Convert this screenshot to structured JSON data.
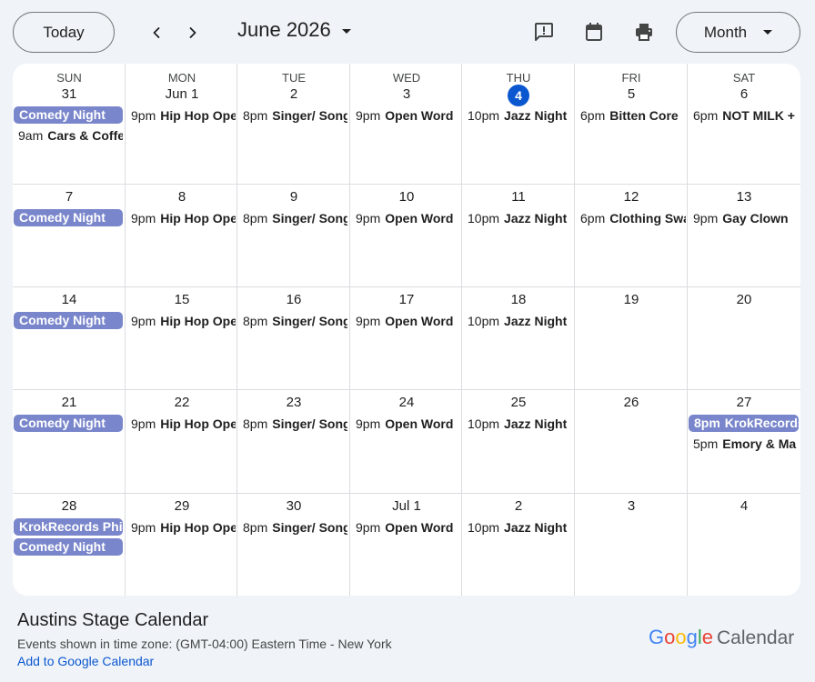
{
  "toolbar": {
    "today_label": "Today",
    "month_title": "June 2026",
    "view_label": "Month",
    "icons": [
      "chevron-left-icon",
      "chevron-right-icon",
      "feedback-icon",
      "calendar-icon",
      "print-icon"
    ]
  },
  "weekdays": [
    "SUN",
    "MON",
    "TUE",
    "WED",
    "THU",
    "FRI",
    "SAT"
  ],
  "weeks": [
    {
      "days": [
        {
          "label": "31",
          "events": [
            {
              "time": "",
              "name": "Comedy Night",
              "bar": true
            },
            {
              "time": "9am",
              "name": "Cars & Coffee"
            }
          ]
        },
        {
          "label": "Jun 1",
          "events": [
            {
              "time": "9pm",
              "name": "Hip Hop Open Mic"
            }
          ]
        },
        {
          "label": "2",
          "events": [
            {
              "time": "8pm",
              "name": "Singer/ Songwriter"
            }
          ]
        },
        {
          "label": "3",
          "events": [
            {
              "time": "9pm",
              "name": "Open Word"
            }
          ]
        },
        {
          "label": "4",
          "today": true,
          "events": [
            {
              "time": "10pm",
              "name": "Jazz Night"
            }
          ]
        },
        {
          "label": "5",
          "events": [
            {
              "time": "6pm",
              "name": "Bitten Core"
            }
          ]
        },
        {
          "label": "6",
          "events": [
            {
              "time": "6pm",
              "name": "NOT MILK +"
            }
          ]
        }
      ]
    },
    {
      "days": [
        {
          "label": "7",
          "events": [
            {
              "time": "",
              "name": "Comedy Night",
              "bar": true
            }
          ]
        },
        {
          "label": "8",
          "events": [
            {
              "time": "9pm",
              "name": "Hip Hop Open Mic"
            }
          ]
        },
        {
          "label": "9",
          "events": [
            {
              "time": "8pm",
              "name": "Singer/ Songwriter"
            }
          ]
        },
        {
          "label": "10",
          "events": [
            {
              "time": "9pm",
              "name": "Open Word"
            }
          ]
        },
        {
          "label": "11",
          "events": [
            {
              "time": "10pm",
              "name": "Jazz Night"
            }
          ]
        },
        {
          "label": "12",
          "events": [
            {
              "time": "6pm",
              "name": "Clothing Swap"
            }
          ]
        },
        {
          "label": "13",
          "events": [
            {
              "time": "9pm",
              "name": "Gay Clown"
            }
          ]
        }
      ]
    },
    {
      "days": [
        {
          "label": "14",
          "events": [
            {
              "time": "",
              "name": "Comedy Night",
              "bar": true
            }
          ]
        },
        {
          "label": "15",
          "events": [
            {
              "time": "9pm",
              "name": "Hip Hop Open Mic"
            }
          ]
        },
        {
          "label": "16",
          "events": [
            {
              "time": "8pm",
              "name": "Singer/ Songwriter"
            }
          ]
        },
        {
          "label": "17",
          "events": [
            {
              "time": "9pm",
              "name": "Open Word"
            }
          ]
        },
        {
          "label": "18",
          "events": [
            {
              "time": "10pm",
              "name": "Jazz Night"
            }
          ]
        },
        {
          "label": "19",
          "events": []
        },
        {
          "label": "20",
          "events": []
        }
      ]
    },
    {
      "days": [
        {
          "label": "21",
          "events": [
            {
              "time": "",
              "name": "Comedy Night",
              "bar": true
            }
          ]
        },
        {
          "label": "22",
          "events": [
            {
              "time": "9pm",
              "name": "Hip Hop Open Mic"
            }
          ]
        },
        {
          "label": "23",
          "events": [
            {
              "time": "8pm",
              "name": "Singer/ Songwriter"
            }
          ]
        },
        {
          "label": "24",
          "events": [
            {
              "time": "9pm",
              "name": "Open Word"
            }
          ]
        },
        {
          "label": "25",
          "events": [
            {
              "time": "10pm",
              "name": "Jazz Night"
            }
          ]
        },
        {
          "label": "26",
          "events": []
        },
        {
          "label": "27",
          "events": [
            {
              "time": "8pm",
              "name": "KrokRecords",
              "bar": true
            },
            {
              "time": "5pm",
              "name": "Emory & Ma"
            }
          ]
        }
      ]
    },
    {
      "days": [
        {
          "label": "28",
          "events": [
            {
              "time": "",
              "name": "KrokRecords Phi",
              "bar": true
            },
            {
              "time": "",
              "name": "Comedy Night",
              "bar": true
            }
          ]
        },
        {
          "label": "29",
          "events": [
            {
              "time": "9pm",
              "name": "Hip Hop Open Mic"
            }
          ]
        },
        {
          "label": "30",
          "events": [
            {
              "time": "8pm",
              "name": "Singer/ Songwriter"
            }
          ]
        },
        {
          "label": "Jul 1",
          "events": [
            {
              "time": "9pm",
              "name": "Open Word"
            }
          ]
        },
        {
          "label": "2",
          "events": [
            {
              "time": "10pm",
              "name": "Jazz Night"
            }
          ]
        },
        {
          "label": "3",
          "events": []
        },
        {
          "label": "4",
          "events": []
        }
      ]
    }
  ],
  "footer": {
    "calendar_name": "Austins Stage Calendar",
    "timezone_text": "Events shown in time zone: (GMT-04:00) Eastern Time - New York",
    "add_link": "Add to Google Calendar",
    "logo_letters": [
      "G",
      "o",
      "o",
      "g",
      "l",
      "e"
    ],
    "logo_product": "Calendar"
  },
  "colors": {
    "event_bar": "#7986cb",
    "today_circle": "#0b57d0",
    "link": "#0b57d0"
  }
}
